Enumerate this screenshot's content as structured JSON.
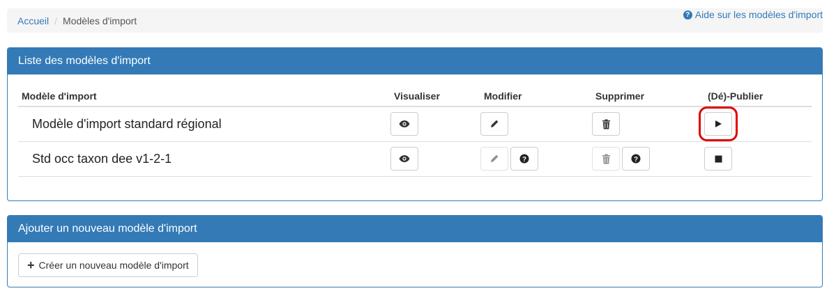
{
  "breadcrumb": {
    "home": "Accueil",
    "current": "Modèles d'import"
  },
  "help": {
    "label": "Aide sur les modèles d'import",
    "icon": "question-circle-icon"
  },
  "list_panel": {
    "title": "Liste des modèles d'import",
    "columns": [
      "Modèle d'import",
      "Visualiser",
      "Modifier",
      "Supprimer",
      "(Dé)-Publier"
    ],
    "rows": [
      {
        "name": "Modèle d'import standard régional",
        "edit_enabled": true,
        "delete_enabled": true,
        "publish_icon": "play-icon"
      },
      {
        "name": "Std occ taxon dee v1-2-1",
        "edit_enabled": false,
        "delete_enabled": false,
        "publish_icon": "stop-icon"
      }
    ]
  },
  "add_panel": {
    "title": "Ajouter un nouveau modèle d'import",
    "create_label": "Créer un nouveau modèle d'import"
  },
  "colors": {
    "primary": "#337ab7",
    "highlight": "#e00000"
  }
}
